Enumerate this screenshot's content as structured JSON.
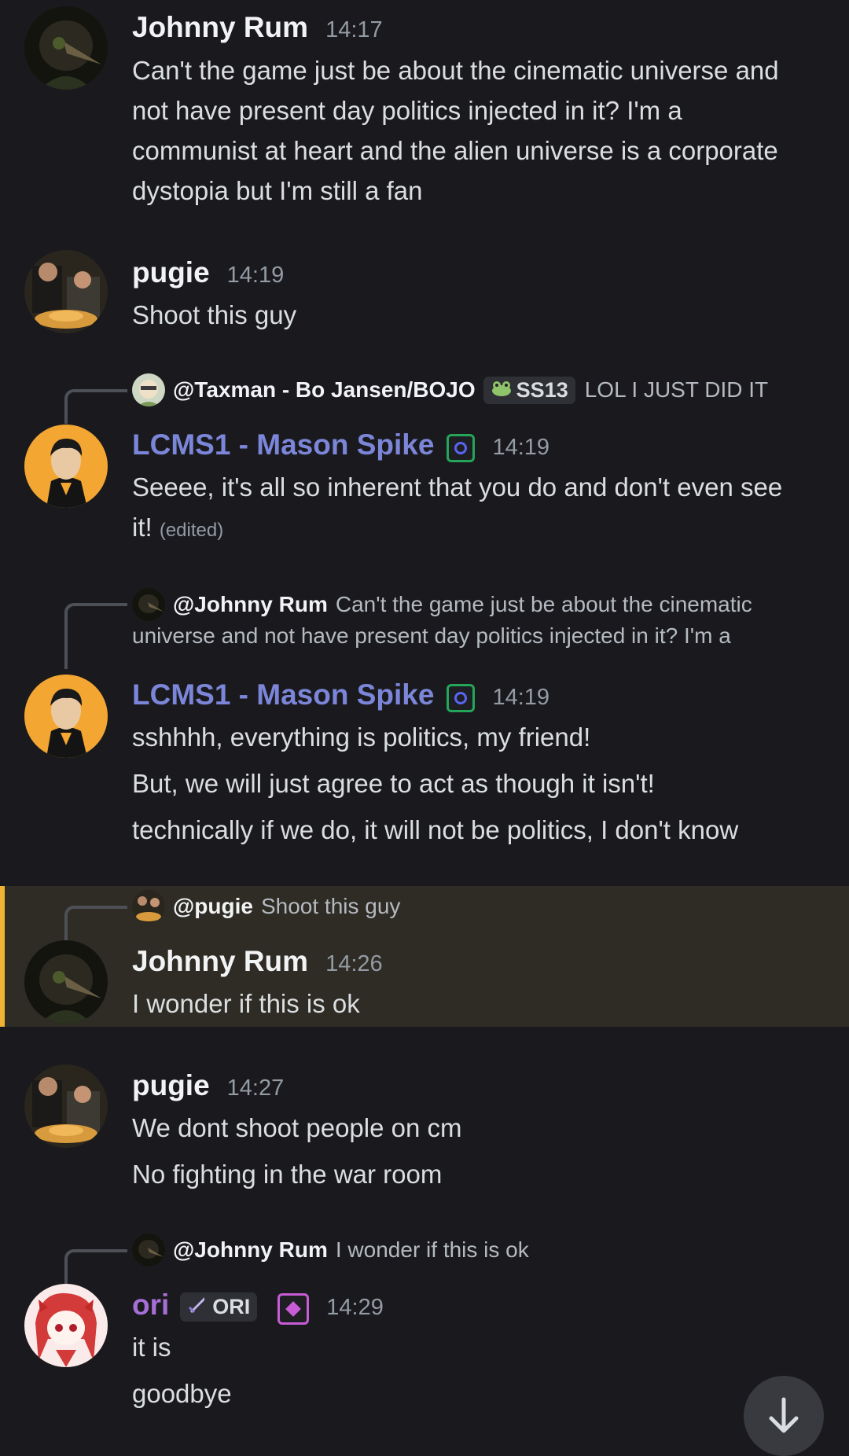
{
  "messages": [
    {
      "author": "Johnny Rum",
      "time": "14:17",
      "lines": [
        "Can't the game just be about the cinematic universe and",
        "not have present day politics injected in it? I'm a",
        "communist at heart and the alien universe is a corporate",
        "dystopia but I'm still a fan"
      ]
    },
    {
      "author": "pugie",
      "time": "14:19",
      "lines": [
        "Shoot this guy"
      ]
    },
    {
      "reply_to": "@Taxman - Bo Jansen/BOJO",
      "reply_tag": "SS13",
      "reply_text": "LOL I JUST DID IT",
      "author": "LCMS1 - Mason Spike",
      "time": "14:19",
      "lines": [
        "Seeee, it's all so inherent that you do and don't even see",
        "it!"
      ],
      "edited": "(edited)"
    },
    {
      "reply_to": "@Johnny Rum",
      "reply_text": "Can't the game just be about the cinematic",
      "reply_text2": "universe and not have present day politics injected in it? I'm a",
      "author": "LCMS1 - Mason Spike",
      "time": "14:19",
      "lines": [
        "sshhhh, everything is politics, my friend!",
        "But, we will just agree to act as though it isn't!",
        "technically if we do, it will not be politics, I don't know"
      ]
    },
    {
      "reply_to": "@pugie",
      "reply_text": "Shoot this guy",
      "author": "Johnny Rum",
      "time": "14:26",
      "lines": [
        "I wonder if this is ok"
      ]
    },
    {
      "author": "pugie",
      "time": "14:27",
      "lines": [
        "We dont shoot people on cm",
        "No fighting in the war room"
      ]
    },
    {
      "reply_to": "@Johnny Rum",
      "reply_text": "I wonder if this is ok",
      "author": "ori",
      "author_tag": "ORI",
      "time": "14:29",
      "lines": [
        "it is",
        "goodbye"
      ]
    }
  ],
  "icons": {
    "scroll": "arrow-down-icon",
    "sword": "sword-icon",
    "frog": "frog-icon"
  },
  "colors": {
    "background": "#1a1a1e",
    "highlight": "#2e2c24",
    "highlight_bar": "#f0b232",
    "role_blue": "#7b86d9",
    "role_purple": "#a66fd6"
  }
}
